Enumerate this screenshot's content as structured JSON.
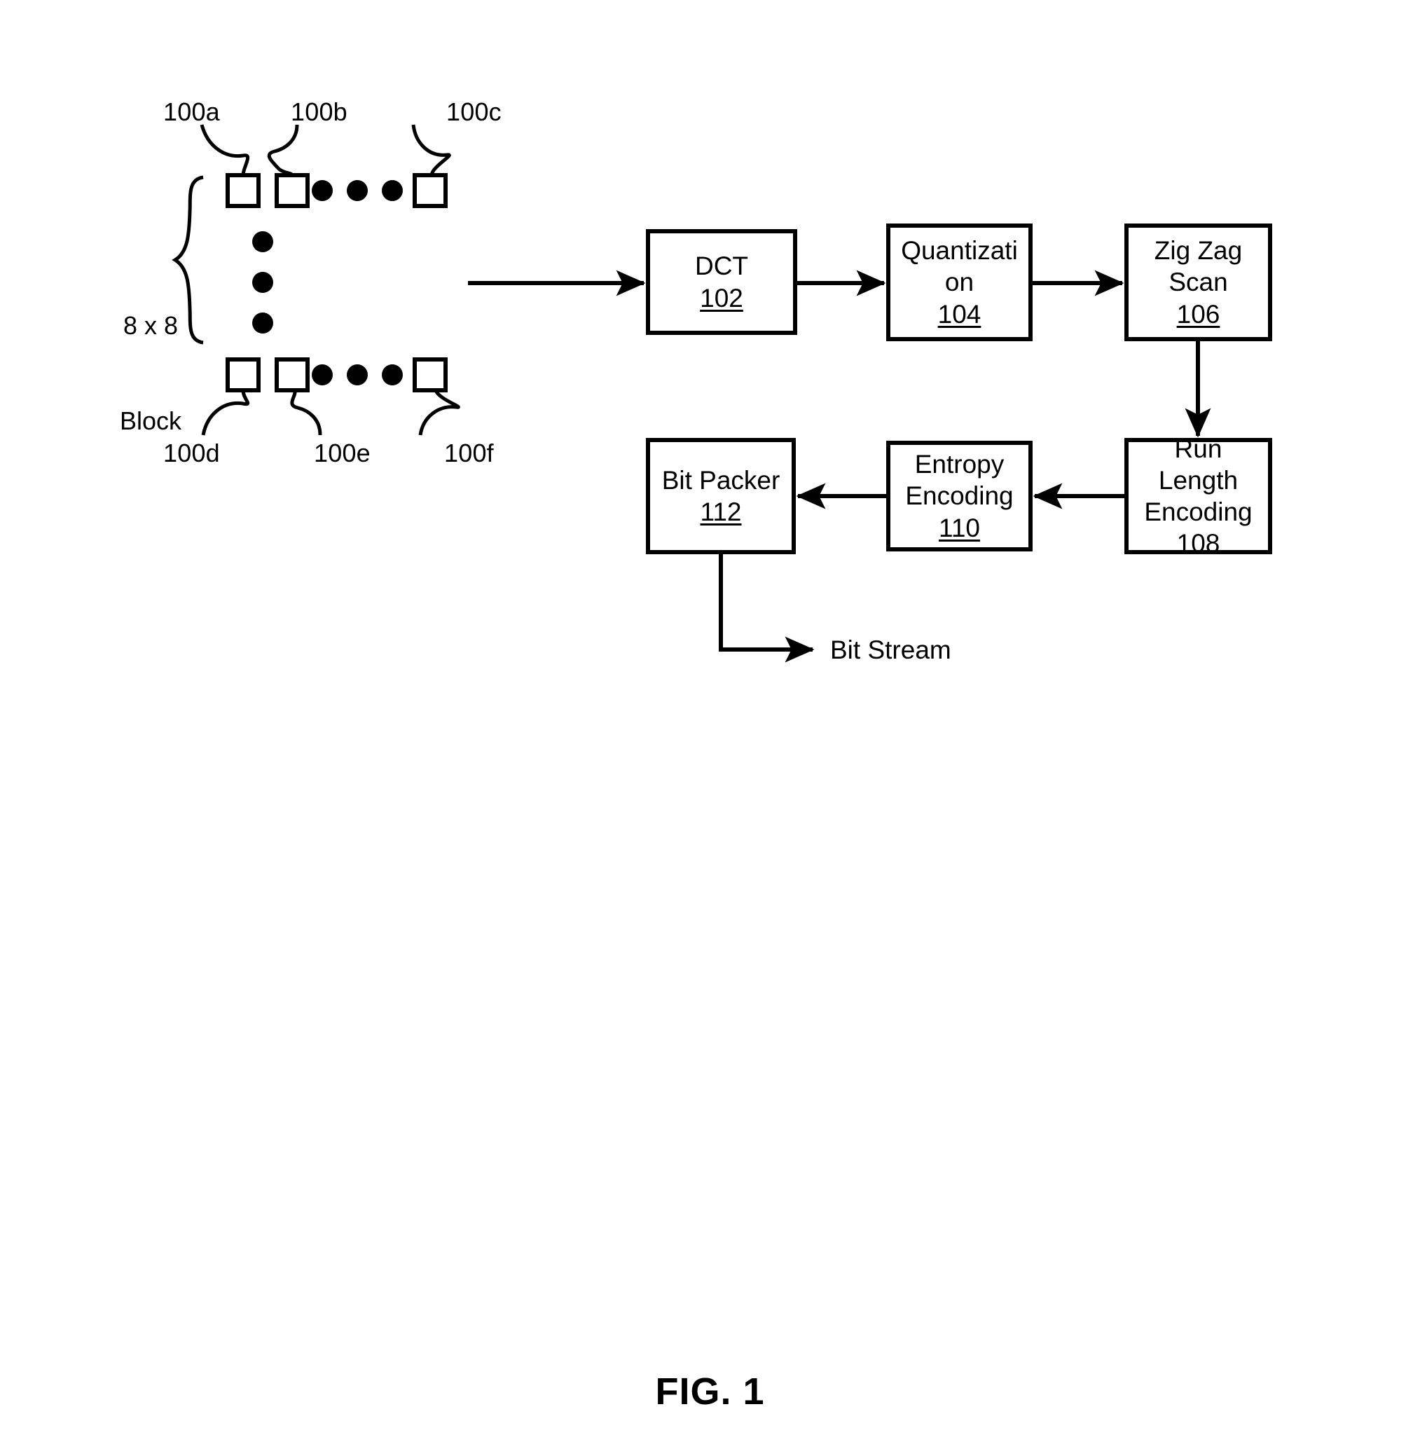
{
  "figure": {
    "caption": "FIG. 1"
  },
  "block_group": {
    "brace_caption_line1": "8 x 8",
    "brace_caption_line2": "Block",
    "cell_refs": [
      {
        "id": "100a",
        "label": "100a"
      },
      {
        "id": "100b",
        "label": "100b"
      },
      {
        "id": "100c",
        "label": "100c"
      },
      {
        "id": "100d",
        "label": "100d"
      },
      {
        "id": "100e",
        "label": "100e"
      },
      {
        "id": "100f",
        "label": "100f"
      }
    ]
  },
  "pipeline": {
    "blocks": [
      {
        "id": "dct",
        "title": "DCT",
        "title2": "",
        "title3": "",
        "number": "102"
      },
      {
        "id": "quant",
        "title": "Quantizati",
        "title2": "on",
        "title3": "",
        "number": "104"
      },
      {
        "id": "zigzag",
        "title": "Zig Zag",
        "title2": "Scan",
        "title3": "",
        "number": "106"
      },
      {
        "id": "rle",
        "title": "Run",
        "title2": "Length",
        "title3": "Encoding",
        "number": "108"
      },
      {
        "id": "entropy",
        "title": "Entropy",
        "title2": "Encoding",
        "title3": "",
        "number": "110"
      },
      {
        "id": "bitpack",
        "title": "Bit Packer",
        "title2": "",
        "title3": "",
        "number": "112"
      }
    ],
    "output_label": "Bit Stream"
  },
  "colors": {
    "ink": "#000000",
    "paper": "#ffffff"
  }
}
